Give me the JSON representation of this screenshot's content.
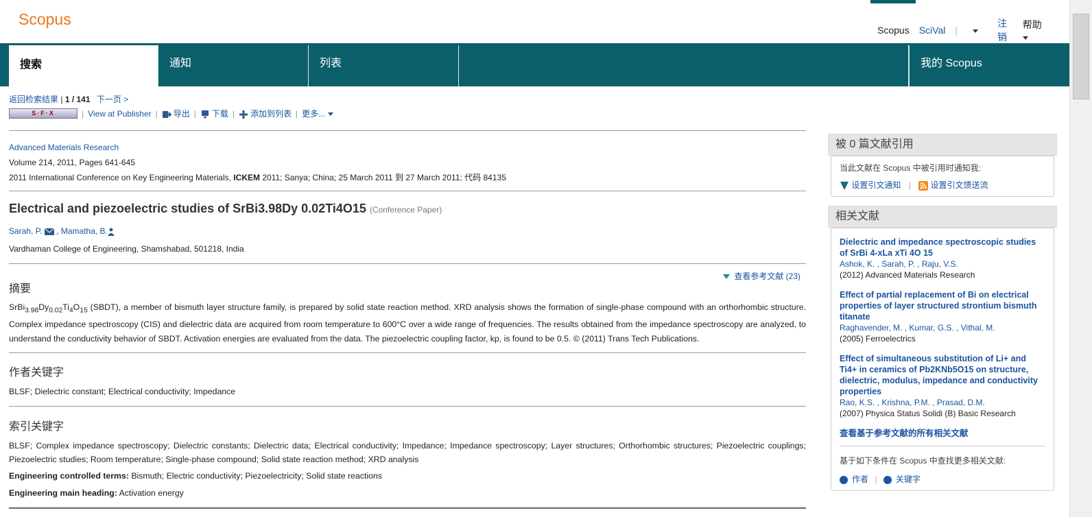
{
  "header": {
    "logo": "Scopus",
    "nav": {
      "scopus": "Scopus",
      "scival": "SciVal",
      "logout": "注销",
      "help": "帮助"
    }
  },
  "tabs": [
    {
      "label": "搜索"
    },
    {
      "label": "通知"
    },
    {
      "label": "列表"
    },
    {
      "label": "我的 Scopus"
    }
  ],
  "nav_results": {
    "back": "返回检索结果",
    "position": "1 / 141",
    "next": "下一页 >"
  },
  "toolbar": {
    "sfx": "S·F·X",
    "publisher": "View at Publisher",
    "export": "导出",
    "download": "下载",
    "add_list": "添加到列表",
    "more": "更多..."
  },
  "source": {
    "journal": "Advanced Materials Research",
    "volume": "Volume 214, 2011, Pages 641-645",
    "conf_prefix": "2011 International Conference on Key Engineering Materials, ",
    "conf_bold": "ICKEM",
    "conf_suffix": " 2011; Sanya; China; 25 March 2011 到 27 March 2011; 代码 84135"
  },
  "article": {
    "title": "Electrical and piezoelectric studies of SrBi3.98Dy 0.02Ti4O15",
    "type": "(Conference Paper)",
    "author1": "Sarah, P.",
    "author2": "Mamatha, B.",
    "affiliation": "Vardhaman College of Engineering, Shamshabad, 501218, India",
    "view_refs": "查看参考文献 (23)"
  },
  "abstract": {
    "heading": "摘要",
    "formula_parts": [
      "SrBi",
      "3.98",
      "Dy",
      "0.02",
      "Ti",
      "4",
      "O",
      "15"
    ],
    "text": " (SBDT), a member of bismuth layer structure family, is prepared by solid state reaction method. XRD analysis shows the formation of single-phase compound with an orthorhombic structure. Complex impedance spectroscopy (CIS) and dielectric data are acquired from room temperature to 600°C over a wide range of frequencies. The results obtained from the impedance spectroscopy are analyzed, to understand the conductivity behavior of SBDT. Activation energies are evaluated from the data. The piezoelectric coupling factor, kp, is found to be 0.5. © (2011) Trans Tech Publications."
  },
  "author_keywords": {
    "heading": "作者关键字",
    "text": "BLSF; Dielectric constant; Electrical conductivity; Impedance"
  },
  "index_keywords": {
    "heading": "索引关键字",
    "text": "BLSF; Complex impedance spectroscopy; Dielectric constants; Dielectric data; Electrical conductivity; Impedance; Impedance spectroscopy; Layer structures; Orthorhombic structures; Piezoelectric couplings; Piezoelectric studies; Room temperature; Single-phase compound; Solid state reaction method; XRD analysis",
    "controlled_label": "Engineering controlled terms:",
    "controlled": " Bismuth; Electric conductivity; Piezoelectricity; Solid state reactions",
    "main_label": "Engineering main heading:",
    "main": " Activation energy"
  },
  "cited": {
    "heading": "被 0 篇文献引用",
    "notify_text": "当此文献在 Scopus 中被引用时通知我:",
    "alert": "设置引文通知",
    "feed": "设置引文馈送流"
  },
  "related": {
    "heading": "相关文献",
    "items": [
      {
        "title": "Dielectric and impedance spectroscopic studies of SrBi 4-xLa xTi 4O 15",
        "authors": "Ashok, K. , Sarah, P. , Raju, V.S.",
        "source": "(2012) Advanced Materials Research"
      },
      {
        "title": "Effect of partial replacement of Bi on electrical properties of layer structured strontium bismuth titanate",
        "authors": "Raghavender, M. , Kumar, G.S. , Vithal, M.",
        "source": "(2005) Ferroelectrics"
      },
      {
        "title": "Effect of simultaneous substitution of Li+ and Ti4+ in ceramics of Pb2KNb5O15 on structure, dielectric, modulus, impedance and conductivity properties",
        "authors": "Rao, K.S. , Krishna, P.M. , Prasad, D.M.",
        "source": "(2007) Physica Status Solidi (B) Basic Research"
      }
    ],
    "view_all": "查看基于参考文献的所有相关文献",
    "find_more": "基于如下条件在 Scopus 中查找更多相关文献:",
    "by_author": "作者",
    "by_keyword": "关键字"
  }
}
